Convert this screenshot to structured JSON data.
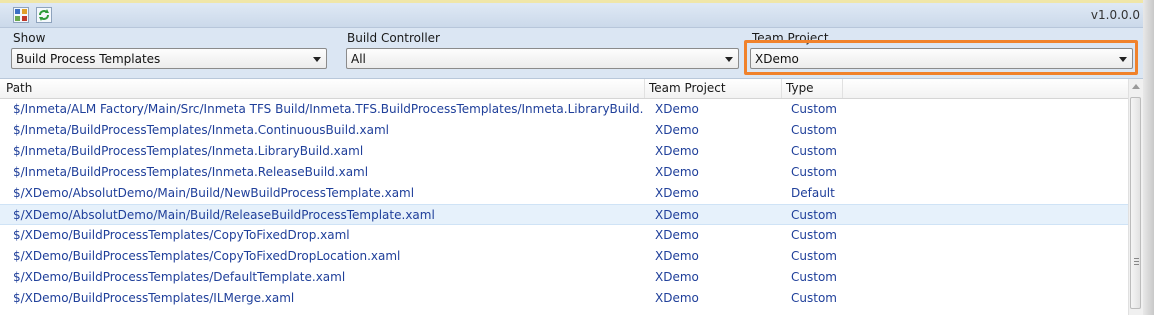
{
  "toolbar": {
    "version": "v1.0.0.0",
    "icons": [
      "layout-icon",
      "refresh-icon"
    ]
  },
  "filters": {
    "show": {
      "label": "Show",
      "value": "Build Process Templates"
    },
    "build_controller": {
      "label": "Build Controller",
      "value": "All"
    },
    "team_project": {
      "label": "Team Project",
      "value": "XDemo"
    }
  },
  "table": {
    "columns": [
      "Path",
      "Team Project",
      "Type"
    ],
    "rows": [
      {
        "path": "$/Inmeta/ALM Factory/Main/Src/Inmeta TFS Build/Inmeta.TFS.BuildProcessTemplates/Inmeta.LibraryBuild.xaml",
        "team": "XDemo",
        "type": "Custom"
      },
      {
        "path": "$/Inmeta/BuildProcessTemplates/Inmeta.ContinuousBuild.xaml",
        "team": "XDemo",
        "type": "Custom"
      },
      {
        "path": "$/Inmeta/BuildProcessTemplates/Inmeta.LibraryBuild.xaml",
        "team": "XDemo",
        "type": "Custom"
      },
      {
        "path": "$/Inmeta/BuildProcessTemplates/Inmeta.ReleaseBuild.xaml",
        "team": "XDemo",
        "type": "Custom"
      },
      {
        "path": "$/XDemo/AbsolutDemo/Main/Build/NewBuildProcessTemplate.xaml",
        "team": "XDemo",
        "type": "Default"
      },
      {
        "path": "$/XDemo/AbsolutDemo/Main/Build/ReleaseBuildProcessTemplate.xaml",
        "team": "XDemo",
        "type": "Custom"
      },
      {
        "path": "$/XDemo/BuildProcessTemplates/CopyToFixedDrop.xaml",
        "team": "XDemo",
        "type": "Custom"
      },
      {
        "path": "$/XDemo/BuildProcessTemplates/CopyToFixedDropLocation.xaml",
        "team": "XDemo",
        "type": "Custom"
      },
      {
        "path": "$/XDemo/BuildProcessTemplates/DefaultTemplate.xaml",
        "team": "XDemo",
        "type": "Custom"
      },
      {
        "path": "$/XDemo/BuildProcessTemplates/ILMerge.xaml",
        "team": "XDemo",
        "type": "Custom"
      }
    ]
  },
  "colors": {
    "link": "#1f3f9a",
    "highlight": "#f0822c",
    "selected_row": "#e6f1fb"
  }
}
